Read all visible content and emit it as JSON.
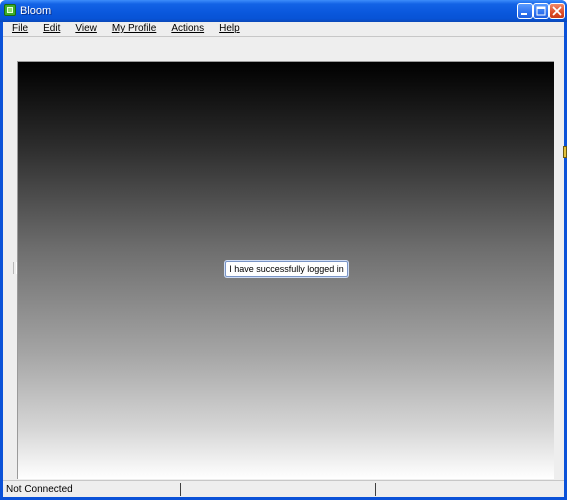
{
  "window": {
    "title": "Bloom",
    "icon": "app-window-icon",
    "controls": {
      "minimize": "minimize-icon",
      "maximize": "maximize-icon",
      "close": "close-icon"
    }
  },
  "menubar": {
    "items": [
      {
        "label": "File"
      },
      {
        "label": "Edit"
      },
      {
        "label": "View"
      },
      {
        "label": "My Profile"
      },
      {
        "label": "Actions"
      },
      {
        "label": "Help"
      }
    ]
  },
  "main": {
    "message": "I have successfully logged in"
  },
  "statusbar": {
    "connection": "Not Connected",
    "cell2": "",
    "cell3": ""
  },
  "colors": {
    "titlebar": "#0a58dd",
    "close_button": "#de4c28",
    "client_bg": "#eeeeee",
    "gradient_top": "#000000",
    "gradient_bottom": "#ffffff"
  }
}
